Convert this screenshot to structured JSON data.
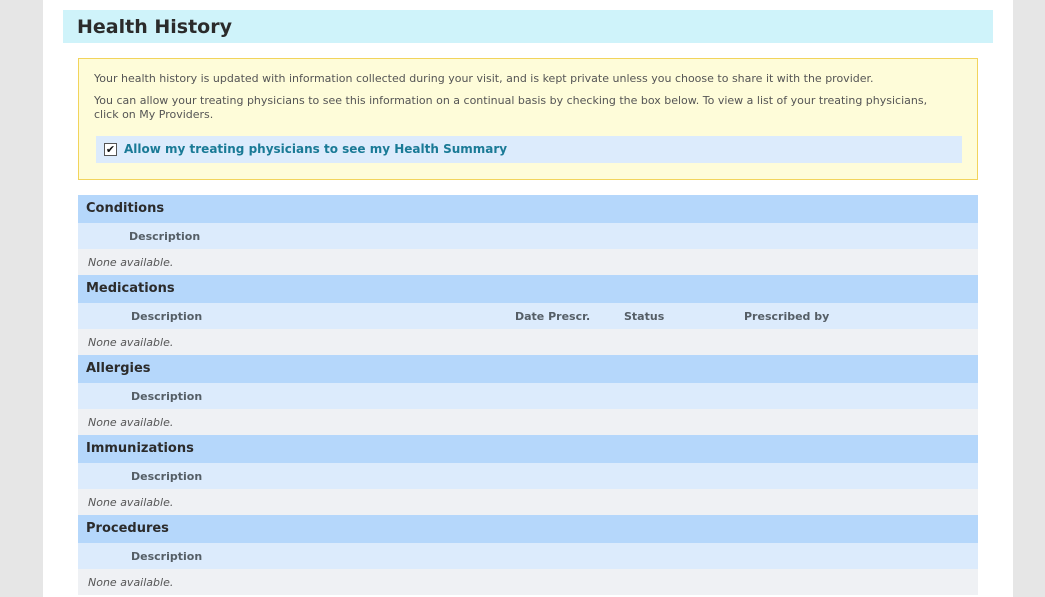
{
  "page": {
    "title": "Health History"
  },
  "notice": {
    "text1": "Your health history is updated with information collected during your visit, and is kept private unless you choose to share it with the provider.",
    "text2": "You can allow your treating physicians to see this information on a continual basis by checking the box below. To view a list of your treating physicians, click on My Providers.",
    "share_checkbox_checked": true,
    "share_label": "Allow my treating physicians to see my Health Summary"
  },
  "sections": {
    "conditions": {
      "title": "Conditions",
      "col_description": "Description",
      "empty_text": "None available."
    },
    "medications": {
      "title": "Medications",
      "col_description": "Description",
      "col_date": "Date Prescr.",
      "col_status": "Status",
      "col_prescribed_by": "Prescribed by",
      "empty_text": "None available."
    },
    "allergies": {
      "title": "Allergies",
      "col_description": "Description",
      "empty_text": "None available."
    },
    "immunizations": {
      "title": "Immunizations",
      "col_description": "Description",
      "empty_text": "None available."
    },
    "procedures": {
      "title": "Procedures",
      "col_description": "Description",
      "empty_text": "None available."
    }
  },
  "colors": {
    "title_bg": "#cff3fa",
    "notice_bg": "#fefcd9",
    "notice_border": "#f2d45c",
    "section_header_bg": "#b5d7fb",
    "column_header_bg": "#dcebfc",
    "empty_row_bg": "#eff1f4",
    "share_label_color": "#1a7a96"
  }
}
